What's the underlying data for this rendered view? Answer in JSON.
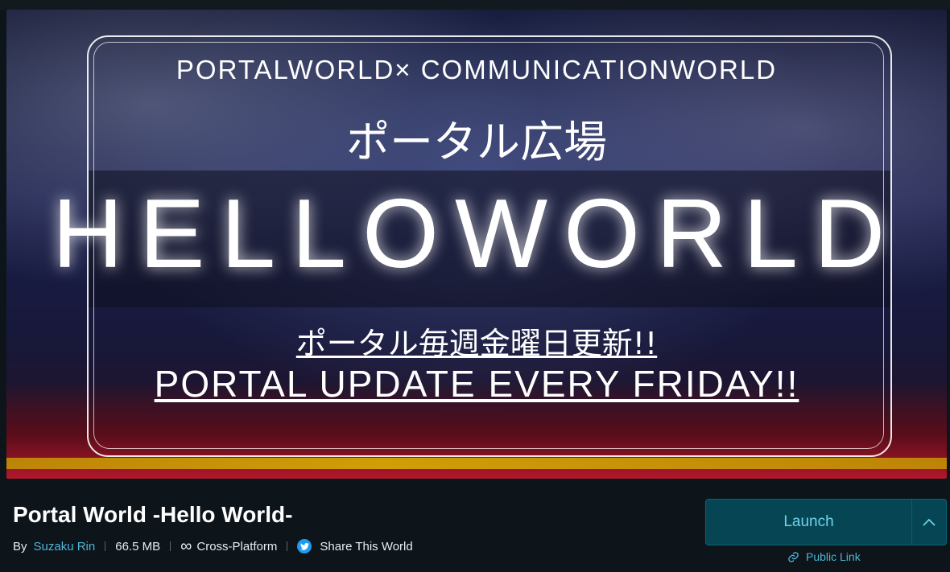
{
  "hero": {
    "line1": "PORTALWORLD× COMMUNICATIONWORLD",
    "line2": "ポータル広場",
    "line3": "HELLOWORLD",
    "line4": "ポータル毎週金曜日更新!!",
    "line5": "PORTAL UPDATE EVERY FRIDAY!!"
  },
  "world": {
    "title": "Portal World -Hello World-",
    "by_label": "By",
    "author": "Suzaku Rin",
    "size": "66.5 MB",
    "platform": "Cross-Platform",
    "share": "Share This World"
  },
  "actions": {
    "launch": "Launch",
    "public_link": "Public Link"
  },
  "colors": {
    "accent": "#4fb6d8",
    "launch_bg": "#064654",
    "twitter": "#1d9bf0"
  }
}
